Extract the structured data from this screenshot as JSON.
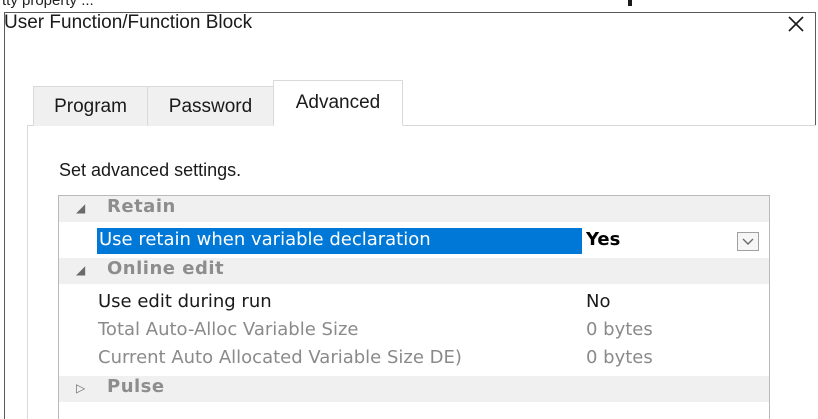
{
  "top_strip_text": "tty property ...",
  "dialog": {
    "title": "User Function/Function Block",
    "close_glyph": "✕"
  },
  "tabs": [
    {
      "label": "Program",
      "active": false
    },
    {
      "label": "Password",
      "active": false
    },
    {
      "label": "Advanced",
      "active": true
    }
  ],
  "description": "Set advanced settings.",
  "property_grid": {
    "categories": [
      {
        "label": "Retain",
        "expanded": true,
        "items": [
          {
            "name": "Use retain when variable declaration",
            "value": "Yes",
            "selected": true,
            "has_dropdown": true
          }
        ]
      },
      {
        "label": "Online edit",
        "expanded": true,
        "items": [
          {
            "name": "Use edit during run",
            "value": "No",
            "enabled": true
          },
          {
            "name": "Total Auto-Alloc Variable Size",
            "value": "0 bytes",
            "enabled": false
          },
          {
            "name": "Current Auto Allocated Variable Size DE)",
            "value": "0 bytes",
            "enabled": false
          }
        ]
      },
      {
        "label": "Pulse",
        "expanded": false,
        "items": []
      }
    ],
    "expand_glyph": "◢",
    "collapse_glyph": "▷"
  },
  "colors": {
    "selection": "#0078d7",
    "category_bg": "#f0f0f0",
    "disabled_text": "#8a8a8a"
  }
}
